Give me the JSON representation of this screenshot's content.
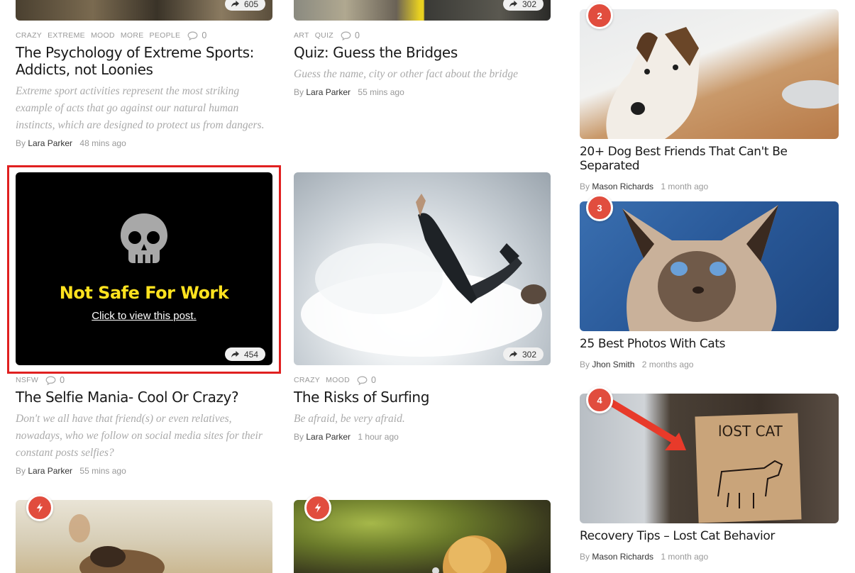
{
  "cards": [
    {
      "share_count": "605",
      "tags": [
        "CRAZY",
        "EXTREME",
        "MOOD",
        "MORE",
        "PEOPLE"
      ],
      "comment_count": "0",
      "title": "The Psychology of Extreme Sports: Addicts, not Loonies",
      "excerpt": "Extreme sport activities represent the most striking example of acts that go against our natural human instincts, which are designed to protect us from dangers.",
      "by_label": "By",
      "author": "Lara Parker",
      "time": "48 mins ago"
    },
    {
      "share_count": "302",
      "tags": [
        "ART",
        "QUIZ"
      ],
      "comment_count": "0",
      "title": "Quiz: Guess the Bridges",
      "excerpt": "Guess the name, city or other fact about the bridge",
      "by_label": "By",
      "author": "Lara Parker",
      "time": "55 mins ago"
    },
    {
      "nsfw_title": "Not Safe For Work",
      "nsfw_link": "Click to view this post.",
      "share_count": "454",
      "tags": [
        "NSFW"
      ],
      "comment_count": "0",
      "title": "The Selfie Mania- Cool Or Crazy?",
      "excerpt": "Don't we all have that friend(s) or even relatives, nowadays, who we follow on social media sites for their constant posts selfies?",
      "by_label": "By",
      "author": "Lara Parker",
      "time": "55 mins ago"
    },
    {
      "share_count": "302",
      "tags": [
        "CRAZY",
        "MOOD"
      ],
      "comment_count": "0",
      "title": "The Risks of Surfing",
      "excerpt": "Be afraid, be very afraid.",
      "by_label": "By",
      "author": "Lara Parker",
      "time": "1 hour ago"
    }
  ],
  "sidebar": [
    {
      "rank": "2",
      "title": "20+ Dog Best Friends That Can't Be Separated",
      "by_label": "By",
      "author": "Mason Richards",
      "time": "1 month ago"
    },
    {
      "rank": "3",
      "title": "25 Best Photos With Cats",
      "by_label": "By",
      "author": "Jhon Smith",
      "time": "2 months ago"
    },
    {
      "rank": "4",
      "title": "Recovery Tips – Lost Cat Behavior",
      "by_label": "By",
      "author": "Mason Richards",
      "time": "1 month ago"
    }
  ],
  "colors": {
    "accent": "#e14d3e",
    "nsfw_title": "#ffe21f",
    "highlight": "#e02020"
  },
  "icons": {
    "share": "share-arrow-icon",
    "comment": "comment-bubble-icon",
    "hot": "lightning-icon",
    "nsfw": "skull-icon"
  }
}
